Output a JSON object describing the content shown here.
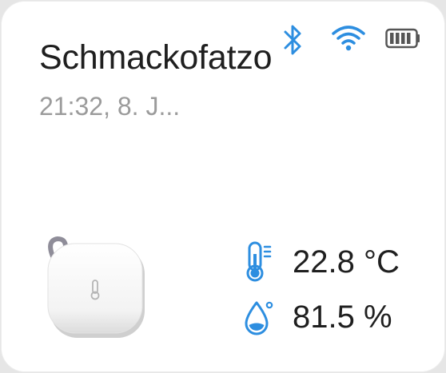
{
  "device": {
    "name": "Schmackofatzo",
    "timestamp": "21:32,  8. J..."
  },
  "status_icons": [
    "bluetooth-icon",
    "wifi-icon",
    "battery-icon"
  ],
  "readings": {
    "temperature": "22.8 °C",
    "humidity": "81.5 %"
  },
  "colors": {
    "accent": "#2d8ee0",
    "title": "#1f1f1f",
    "subtitle": "#9b9b9b",
    "battery": "#555555"
  }
}
